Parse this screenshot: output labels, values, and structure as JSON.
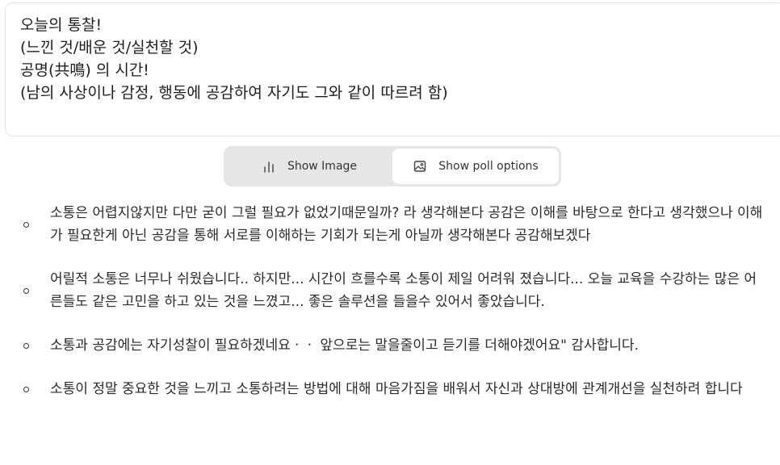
{
  "prompt": {
    "lines": [
      "오늘의 통찰!",
      "(느낀 것/배운 것/실천할 것)",
      "공명(共鳴) 의 시간!",
      "(남의 사상이나 감정, 행동에 공감하여 자기도 그와 같이 따르려 함)"
    ]
  },
  "toggle": {
    "show_image_label": "Show Image",
    "show_image_icon": "bar-chart-icon",
    "show_poll_label": "Show poll options",
    "show_poll_icon": "image-icon",
    "active": "show_poll_options"
  },
  "answers": [
    "소통은 어렵지않지만 다만 굳이 그럴 필요가 없었기때문일까? 라 생각해본다 공감은 이해를 바탕으로 한다고 생각했으나 이해가 필요한게 아닌 공감을 통해 서로를 이해하는 기회가 되는게 아닐까 생각해본다 공감해보겠다",
    "어릴적 소통은 너무나 쉬웠습니다.. 하지만... 시간이 흐를수록 소통이 제일 어려워 졌습니다... 오늘 교육을 수강하는 많은 어른들도 같은 고민을 하고 있는 것을 느꼈고... 좋은 솔루션을 들을수 있어서 좋았습니다.",
    "소통과 공감에는 자기성찰이 필요하겠네요ㆍㆍ 앞으로는 말을줄이고 듣기를 더해야겠어요\" 감사합니다.",
    "소통이 정말 중요한 것을 느끼고 소통하려는 방법에 대해 마음가짐을 배워서 자신과 상대방에 관계개선을 실천하려 합니다"
  ]
}
